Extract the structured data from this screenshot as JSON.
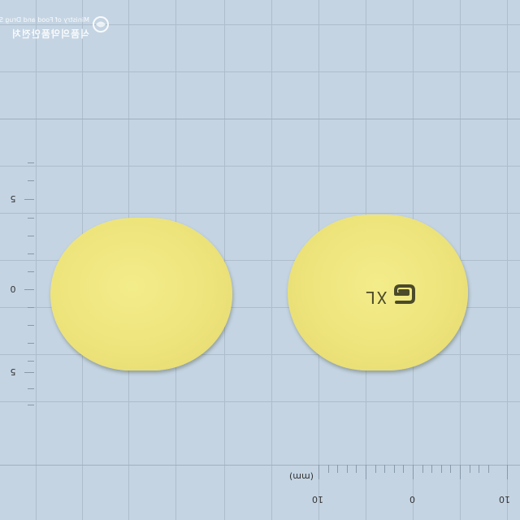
{
  "watermark": {
    "org_en": "Ministry of Food and Drug Safety",
    "org_kr": "식품의약품안전처"
  },
  "vertical_ruler": {
    "labels": [
      "5",
      "0",
      "5"
    ]
  },
  "horizontal_ruler": {
    "unit": "(mm)",
    "labels": [
      "10",
      "0",
      "10"
    ]
  },
  "pill_right": {
    "imprint": "XL"
  },
  "colors": {
    "background": "#c4d4e3",
    "pill": "#eee47c",
    "imprint": "#4b4a2a"
  }
}
